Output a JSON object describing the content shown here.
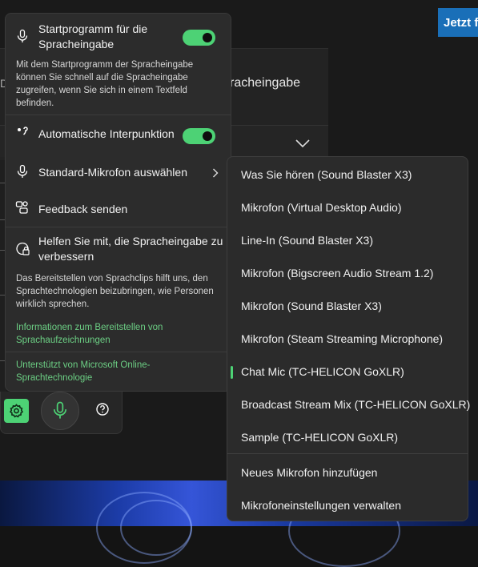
{
  "background": {
    "jetzt_button": "Jetzt fi",
    "setting_text": "racheingabe",
    "left_fragment": "D"
  },
  "voice_panel": {
    "launcher": {
      "title": "Startprogramm für die Spracheingabe",
      "toggle_on": true,
      "description": "Mit dem Startprogramm der Spracheingabe können Sie schnell auf die Spracheingabe zugreifen, wenn Sie sich in einem Textfeld befinden."
    },
    "auto_punctuation": {
      "title": "Automatische Interpunktion",
      "toggle_on": true
    },
    "select_mic": {
      "title": "Standard-Mikrofon auswählen"
    },
    "feedback": {
      "title": "Feedback senden"
    },
    "improve": {
      "title": "Helfen Sie mit, die Spracheingabe zu verbessern",
      "description": "Das Bereitstellen von Sprachclips hilft uns, den Sprachtechnologien beizubringen, wie Personen wirklich sprechen.",
      "link": "Informationen zum Bereitstellen von Sprachaufzeichnungen"
    },
    "powered_by": "Unterstützt von Microsoft Online-Sprachtechnologie"
  },
  "toolbar": {
    "settings_icon": "gear-icon",
    "mic_icon": "microphone-icon",
    "help_icon": "help-icon"
  },
  "mic_menu": {
    "items": [
      "Was Sie hören (Sound Blaster X3)",
      "Mikrofon (Virtual Desktop Audio)",
      "Line-In (Sound Blaster X3)",
      "Mikrofon (Bigscreen Audio Stream 1.2)",
      "Mikrofon (Sound Blaster X3)",
      "Mikrofon (Steam Streaming Microphone)",
      "Chat Mic (TC-HELICON GoXLR)",
      "Broadcast Stream Mix (TC-HELICON GoXLR)",
      "Sample (TC-HELICON GoXLR)"
    ],
    "selected": "Chat Mic (TC-HELICON GoXLR)",
    "add_mic": "Neues Mikrofon hinzufügen",
    "manage": "Mikrofoneinstellungen verwalten"
  },
  "colors": {
    "accent_green": "#4dd275",
    "link_green": "#6ccf84",
    "panel_bg": "#2c2c2c",
    "button_blue": "#1a6fb8"
  }
}
